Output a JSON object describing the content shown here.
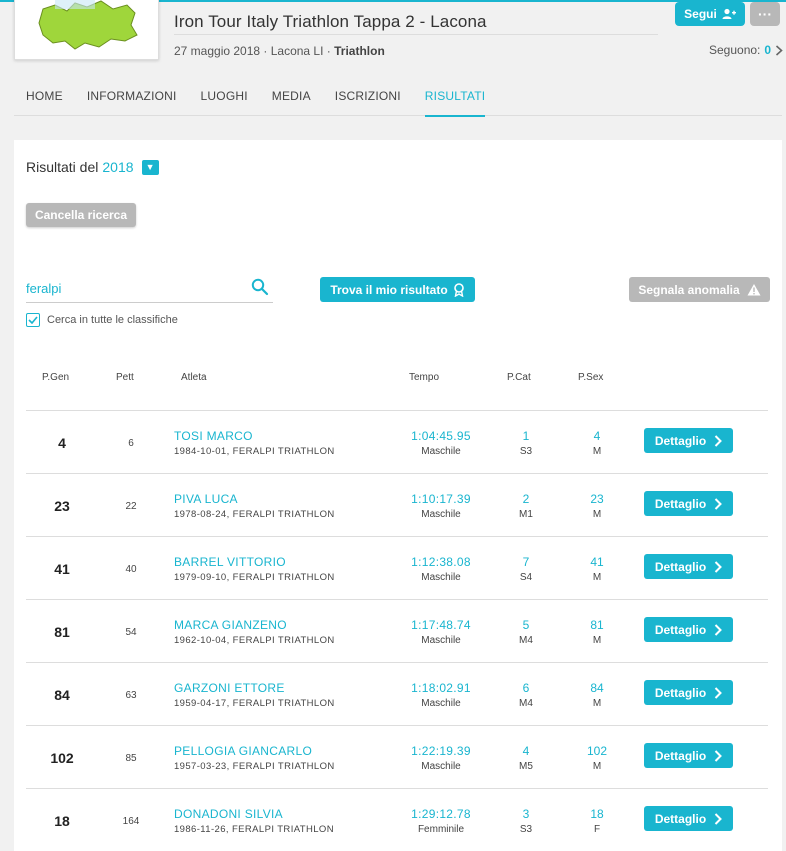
{
  "event": {
    "title": "Iron Tour Italy Triathlon Tappa 2 - Lacona",
    "date_location": "27 maggio 2018 · Lacona LI · ",
    "sport": "Triathlon"
  },
  "header": {
    "follow_label": "Segui",
    "more_label": "···",
    "followers_label": "Seguono:",
    "followers_count": "0"
  },
  "nav": {
    "tabs": [
      "HOME",
      "INFORMAZIONI",
      "LUOGHI",
      "MEDIA",
      "ISCRIZIONI",
      "RISULTATI"
    ],
    "active": "RISULTATI"
  },
  "results": {
    "year_label": "Risultati del",
    "year": "2018",
    "clear_label": "Cancella ricerca",
    "search_value": "feralpi",
    "find_label": "Trova il mio risultato",
    "report_label": "Segnala anomalia",
    "search_all_label": "Cerca in tutte le classifiche",
    "search_all_checked": true
  },
  "table": {
    "headers": [
      "P.Gen",
      "Pett",
      "Atleta",
      "Tempo",
      "P.Cat",
      "P.Sex"
    ],
    "detail_label": "Dettaglio",
    "rows": [
      {
        "pgen": "4",
        "pett": "6",
        "name": "TOSI MARCO",
        "info": "1984-10-01, FERALPI TRIATHLON",
        "time": "1:04:45.95",
        "gender": "Maschile",
        "pcat": "1",
        "cat": "S3",
        "psex": "4",
        "sex": "M"
      },
      {
        "pgen": "23",
        "pett": "22",
        "name": "PIVA LUCA",
        "info": "1978-08-24, FERALPI TRIATHLON",
        "time": "1:10:17.39",
        "gender": "Maschile",
        "pcat": "2",
        "cat": "M1",
        "psex": "23",
        "sex": "M"
      },
      {
        "pgen": "41",
        "pett": "40",
        "name": "BARREL VITTORIO",
        "info": "1979-09-10, FERALPI TRIATHLON",
        "time": "1:12:38.08",
        "gender": "Maschile",
        "pcat": "7",
        "cat": "S4",
        "psex": "41",
        "sex": "M"
      },
      {
        "pgen": "81",
        "pett": "54",
        "name": "MARCA GIANZENO",
        "info": "1962-10-04, FERALPI TRIATHLON",
        "time": "1:17:48.74",
        "gender": "Maschile",
        "pcat": "5",
        "cat": "M4",
        "psex": "81",
        "sex": "M"
      },
      {
        "pgen": "84",
        "pett": "63",
        "name": "GARZONI ETTORE",
        "info": "1959-04-17, FERALPI TRIATHLON",
        "time": "1:18:02.91",
        "gender": "Maschile",
        "pcat": "6",
        "cat": "M4",
        "psex": "84",
        "sex": "M"
      },
      {
        "pgen": "102",
        "pett": "85",
        "name": "PELLOGIA GIANCARLO",
        "info": "1957-03-23, FERALPI TRIATHLON",
        "time": "1:22:19.39",
        "gender": "Maschile",
        "pcat": "4",
        "cat": "M5",
        "psex": "102",
        "sex": "M"
      },
      {
        "pgen": "18",
        "pett": "164",
        "name": "DONADONI SILVIA",
        "info": "1986-11-26, FERALPI TRIATHLON",
        "time": "1:29:12.78",
        "gender": "Femminile",
        "pcat": "3",
        "cat": "S3",
        "psex": "18",
        "sex": "F"
      }
    ]
  },
  "colors": {
    "accent": "#19b5cf",
    "muted_button": "#b8b8b8",
    "background": "#f1f1f1"
  }
}
